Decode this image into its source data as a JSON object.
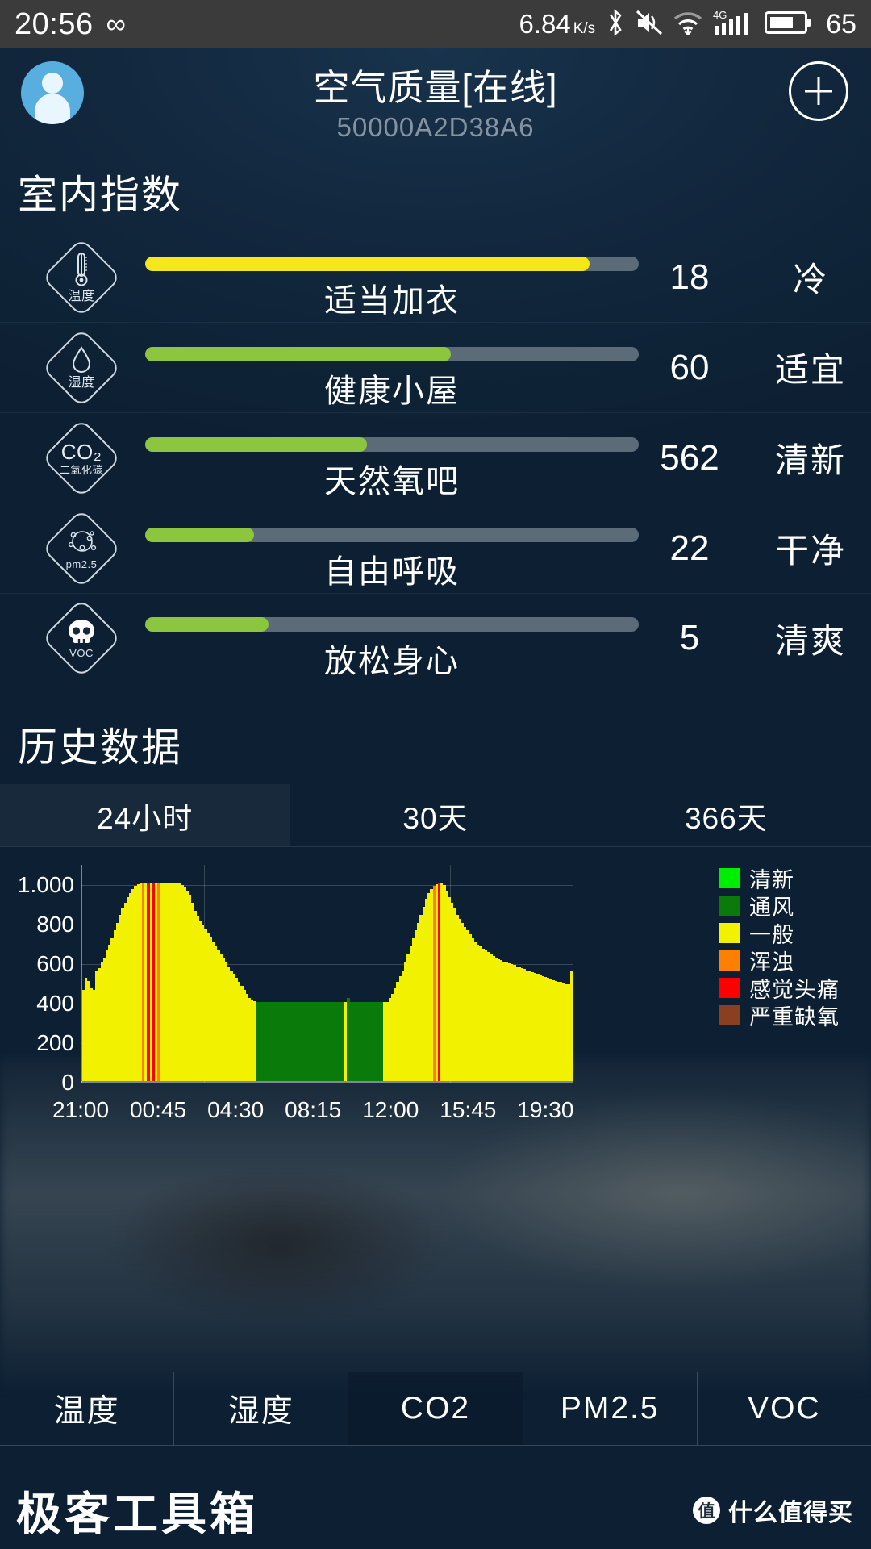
{
  "statusbar": {
    "time": "20:56",
    "infinity_icon": "∞",
    "net_speed": "6.84",
    "net_speed_unit": "K/s",
    "bluetooth_icon": "bluetooth-icon",
    "mute_icon": "mute-icon",
    "wifi_icon": "wifi-icon",
    "network_type": "4G",
    "signal_icon": "signal-bars-icon",
    "battery_icon": "battery-icon",
    "battery_level": "65"
  },
  "header": {
    "avatar": "user-avatar",
    "title": "空气质量[在线]",
    "device_id": "50000A2D38A6",
    "add_label": "+"
  },
  "indoor": {
    "section_title": "室内指数",
    "items": [
      {
        "icon_big": "",
        "icon_caption": "温度",
        "icon_name": "thermometer-icon",
        "percent": 90,
        "color": "#f5e71a",
        "advice": "适当加衣",
        "value": "18",
        "status": "冷"
      },
      {
        "icon_big": "",
        "icon_caption": "湿度",
        "icon_name": "water-drop-icon",
        "percent": 62,
        "color": "#8cc63e",
        "advice": "健康小屋",
        "value": "60",
        "status": "适宜"
      },
      {
        "icon_big": "CO₂",
        "icon_caption": "二氧化碳",
        "icon_name": "co2-icon",
        "percent": 45,
        "color": "#8cc63e",
        "advice": "天然氧吧",
        "value": "562",
        "status": "清新"
      },
      {
        "icon_big": "",
        "icon_caption": "pm2.5",
        "icon_name": "pm25-particles-icon",
        "percent": 22,
        "color": "#8cc63e",
        "advice": "自由呼吸",
        "value": "22",
        "status": "干净"
      },
      {
        "icon_big": "",
        "icon_caption": "VOC",
        "icon_name": "skull-icon",
        "percent": 25,
        "color": "#8cc63e",
        "advice": "放松身心",
        "value": "5",
        "status": "清爽"
      }
    ]
  },
  "history": {
    "section_title": "历史数据",
    "tabs": [
      {
        "label": "24小时",
        "active": true
      },
      {
        "label": "30天",
        "active": false
      },
      {
        "label": "366天",
        "active": false
      }
    ]
  },
  "chart_data": {
    "type": "bar",
    "title": "历史数据",
    "xlabel": "",
    "ylabel": "",
    "ylim": [
      0,
      1100
    ],
    "yticks": [
      0,
      200,
      400,
      600,
      800,
      1000
    ],
    "ytick_labels": [
      "0",
      "200",
      "400",
      "600",
      "800",
      "1.000"
    ],
    "xtick_labels": [
      "21:00",
      "00:45",
      "04:30",
      "08:15",
      "12:00",
      "15:45",
      "19:30"
    ],
    "grid": true,
    "legend_position": "right",
    "legend": [
      {
        "label": "清新",
        "color": "#00ee00"
      },
      {
        "label": "通风",
        "color": "#0a7a0a"
      },
      {
        "label": "一般",
        "color": "#f2f200"
      },
      {
        "label": "浑浊",
        "color": "#ff8000"
      },
      {
        "label": "感觉头痛",
        "color": "#ff0000"
      },
      {
        "label": "严重缺氧",
        "color": "#8a4020"
      }
    ],
    "values": [
      460,
      520,
      505,
      470,
      460,
      560,
      570,
      600,
      620,
      660,
      690,
      720,
      760,
      800,
      840,
      870,
      900,
      930,
      950,
      970,
      985,
      995,
      1000,
      1000,
      1000,
      1000,
      1000,
      1000,
      1000,
      1000,
      1000,
      1000,
      1000,
      1000,
      1000,
      1000,
      1000,
      1000,
      990,
      980,
      960,
      940,
      900,
      860,
      830,
      810,
      790,
      770,
      750,
      730,
      700,
      680,
      660,
      640,
      620,
      600,
      580,
      560,
      540,
      520,
      500,
      480,
      460,
      440,
      420,
      410,
      405,
      400,
      400,
      400,
      400,
      400,
      400,
      400,
      400,
      400,
      400,
      400,
      400,
      400,
      400,
      400,
      400,
      400,
      400,
      400,
      400,
      400,
      400,
      400,
      400,
      400,
      400,
      400,
      400,
      400,
      400,
      400,
      400,
      400,
      400,
      400,
      420,
      400,
      400,
      400,
      400,
      400,
      400,
      400,
      400,
      400,
      400,
      400,
      400,
      400,
      400,
      400,
      420,
      440,
      470,
      500,
      530,
      560,
      600,
      640,
      680,
      720,
      760,
      800,
      840,
      880,
      920,
      950,
      970,
      985,
      995,
      1000,
      1000,
      990,
      960,
      930,
      900,
      870,
      840,
      820,
      800,
      780,
      760,
      740,
      720,
      700,
      690,
      680,
      670,
      660,
      650,
      640,
      630,
      620,
      615,
      610,
      605,
      600,
      595,
      590,
      585,
      580,
      575,
      570,
      565,
      560,
      555,
      550,
      545,
      540,
      535,
      530,
      525,
      520,
      515,
      510,
      505,
      500,
      500,
      495,
      490,
      490,
      560
    ],
    "colors": [
      "#f2f200",
      "#f2f200",
      "#f2f200",
      "#f2f200",
      "#f2f200",
      "#f2f200",
      "#f2f200",
      "#f2f200",
      "#f2f200",
      "#f2f200",
      "#f2f200",
      "#f2f200",
      "#f2f200",
      "#f2f200",
      "#f2f200",
      "#f2f200",
      "#f2f200",
      "#f2f200",
      "#f2f200",
      "#f2f200",
      "#f2f200",
      "#f2f200",
      "#f2f200",
      "#ff8000",
      "#f2f200",
      "#ff0000",
      "#f2f200",
      "#ff0000",
      "#f2f200",
      "#ff8000",
      "#f2f200",
      "#f2f200",
      "#f2f200",
      "#f2f200",
      "#f2f200",
      "#f2f200",
      "#f2f200",
      "#f2f200",
      "#f2f200",
      "#f2f200",
      "#f2f200",
      "#f2f200",
      "#f2f200",
      "#f2f200",
      "#f2f200",
      "#f2f200",
      "#f2f200",
      "#f2f200",
      "#f2f200",
      "#f2f200",
      "#f2f200",
      "#f2f200",
      "#f2f200",
      "#f2f200",
      "#f2f200",
      "#f2f200",
      "#f2f200",
      "#f2f200",
      "#f2f200",
      "#f2f200",
      "#f2f200",
      "#f2f200",
      "#f2f200",
      "#f2f200",
      "#f2f200",
      "#f2f200",
      "#f2f200",
      "#0a7a0a",
      "#0a7a0a",
      "#0a7a0a",
      "#0a7a0a",
      "#0a7a0a",
      "#0a7a0a",
      "#0a7a0a",
      "#0a7a0a",
      "#0a7a0a",
      "#0a7a0a",
      "#0a7a0a",
      "#0a7a0a",
      "#0a7a0a",
      "#0a7a0a",
      "#0a7a0a",
      "#0a7a0a",
      "#0a7a0a",
      "#0a7a0a",
      "#0a7a0a",
      "#0a7a0a",
      "#0a7a0a",
      "#0a7a0a",
      "#0a7a0a",
      "#0a7a0a",
      "#0a7a0a",
      "#0a7a0a",
      "#0a7a0a",
      "#0a7a0a",
      "#0a7a0a",
      "#0a7a0a",
      "#0a7a0a",
      "#0a7a0a",
      "#0a7a0a",
      "#0a7a0a",
      "#f2f200",
      "#0a7a0a",
      "#0a7a0a",
      "#0a7a0a",
      "#0a7a0a",
      "#0a7a0a",
      "#0a7a0a",
      "#0a7a0a",
      "#0a7a0a",
      "#0a7a0a",
      "#0a7a0a",
      "#0a7a0a",
      "#0a7a0a",
      "#0a7a0a",
      "#0a7a0a",
      "#f2f200",
      "#f2f200",
      "#f2f200",
      "#f2f200",
      "#f2f200",
      "#f2f200",
      "#f2f200",
      "#f2f200",
      "#f2f200",
      "#f2f200",
      "#f2f200",
      "#f2f200",
      "#f2f200",
      "#f2f200",
      "#f2f200",
      "#f2f200",
      "#f2f200",
      "#f2f200",
      "#f2f200",
      "#ff8000",
      "#f2f200",
      "#ff0000",
      "#f2f200",
      "#f2f200",
      "#f2f200",
      "#f2f200",
      "#f2f200",
      "#f2f200",
      "#f2f200",
      "#f2f200",
      "#f2f200",
      "#f2f200",
      "#f2f200",
      "#f2f200",
      "#f2f200",
      "#f2f200",
      "#f2f200",
      "#f2f200",
      "#f2f200",
      "#f2f200",
      "#f2f200",
      "#f2f200",
      "#f2f200",
      "#f2f200",
      "#f2f200",
      "#f2f200",
      "#f2f200",
      "#f2f200",
      "#f2f200",
      "#f2f200",
      "#f2f200",
      "#f2f200",
      "#f2f200",
      "#f2f200",
      "#f2f200",
      "#f2f200",
      "#f2f200",
      "#f2f200",
      "#f2f200",
      "#f2f200",
      "#f2f200",
      "#f2f200",
      "#f2f200",
      "#f2f200",
      "#f2f200",
      "#f2f200",
      "#f2f200",
      "#f2f200",
      "#f2f200"
    ]
  },
  "bottom_tabs": [
    {
      "label": "温度",
      "active": false
    },
    {
      "label": "湿度",
      "active": false
    },
    {
      "label": "CO2",
      "active": true
    },
    {
      "label": "PM2.5",
      "active": false
    },
    {
      "label": "VOC",
      "active": false
    }
  ],
  "footer": {
    "brand": "极客工具箱",
    "watermark_mark": "值",
    "watermark_text": "什么值得买"
  }
}
